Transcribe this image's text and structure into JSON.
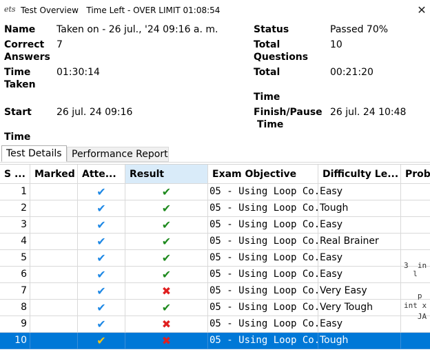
{
  "window": {
    "logo_text": "ets",
    "title": "Test Overview   Time Left - OVER LIMIT 01:08:54",
    "close_glyph": "✕"
  },
  "summary": {
    "name_label": "Name",
    "name_value": "Taken on - 26 jul., '24 09:16 a. m.",
    "correct_label_1": "Correct",
    "correct_label_2": "Answers",
    "correct_value": "7",
    "time_taken_label_1": "Time",
    "time_taken_label_2": "Taken",
    "time_taken_value": "01:30:14",
    "start_label_1": "Start",
    "start_label_2": "Time",
    "start_value": "26 jul. 24 09:16",
    "status_label": "Status",
    "status_value": "Passed 70%",
    "total_q_label_1": "Total",
    "total_q_label_2": "Questions",
    "total_q_value": "10",
    "total_time_label_1": "Total",
    "total_time_label_2": "Time",
    "total_time_value": "00:21:20",
    "finish_label_1": "Finish/Pause",
    "finish_label_2": "Time",
    "finish_value": "26 jul. 24 10:48"
  },
  "tabs": [
    {
      "label": "Test Details",
      "active": true
    },
    {
      "label": "Performance Report",
      "active": false
    }
  ],
  "grid": {
    "headers": [
      "S ...",
      "Marked",
      "Atte...",
      "Result",
      "Exam Objective",
      "Difficulty Le...",
      "Prob"
    ],
    "rows": [
      {
        "num": "1",
        "marked": "",
        "attempted": "✔",
        "result": "✔",
        "objective": "05 - Using Loop Co...",
        "difficulty": "Easy"
      },
      {
        "num": "2",
        "marked": "",
        "attempted": "✔",
        "result": "✔",
        "objective": "05 - Using Loop Co...",
        "difficulty": "Tough"
      },
      {
        "num": "3",
        "marked": "",
        "attempted": "✔",
        "result": "✔",
        "objective": "05 - Using Loop Co...",
        "difficulty": "Easy"
      },
      {
        "num": "4",
        "marked": "",
        "attempted": "✔",
        "result": "✔",
        "objective": "05 - Using Loop Co...",
        "difficulty": "Real Brainer"
      },
      {
        "num": "5",
        "marked": "",
        "attempted": "✔",
        "result": "✔",
        "objective": "05 - Using Loop Co...",
        "difficulty": "Easy"
      },
      {
        "num": "6",
        "marked": "",
        "attempted": "✔",
        "result": "✔",
        "objective": "05 - Using Loop Co...",
        "difficulty": "Easy"
      },
      {
        "num": "7",
        "marked": "",
        "attempted": "✔",
        "result": "✖",
        "objective": "05 - Using Loop Co...",
        "difficulty": "Very Easy"
      },
      {
        "num": "8",
        "marked": "",
        "attempted": "✔",
        "result": "✔",
        "objective": "05 - Using Loop Co...",
        "difficulty": "Very Tough"
      },
      {
        "num": "9",
        "marked": "",
        "attempted": "✔",
        "result": "✖",
        "objective": "05 - Using Loop Co...",
        "difficulty": "Easy"
      },
      {
        "num": "10",
        "marked": "",
        "attempted": "✔",
        "result": "✖",
        "objective": "05 - Using Loop Co...",
        "difficulty": "Tough"
      }
    ],
    "selected_row": "10",
    "problem_snippets": [
      "3  in",
      "  l",
      "   p",
      "int x",
      "   JA"
    ]
  },
  "colors": {
    "selection": "#0078d7",
    "correct": "#1e8a1e",
    "incorrect": "#e02020",
    "attempted": "#1e88e5"
  }
}
